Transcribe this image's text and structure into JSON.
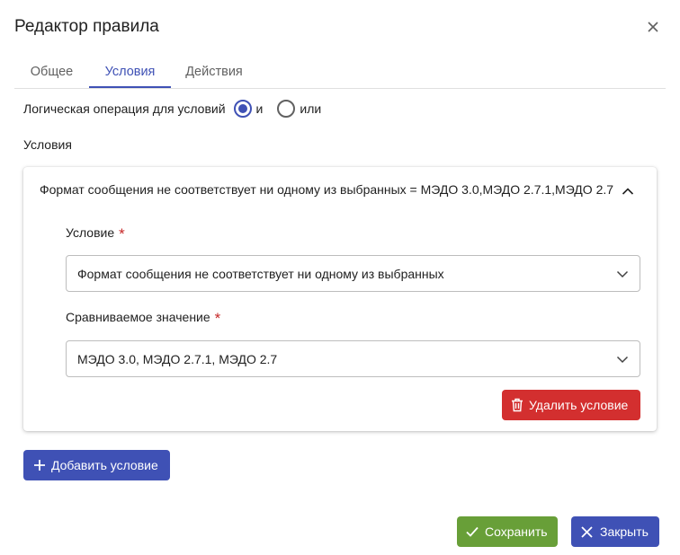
{
  "dialog": {
    "title": "Редактор правила",
    "close_icon": "close-icon"
  },
  "tabs": [
    {
      "label": "Общее",
      "active": false
    },
    {
      "label": "Условия",
      "active": true
    },
    {
      "label": "Действия",
      "active": false
    }
  ],
  "logic": {
    "label": "Логическая операция для условий",
    "options": [
      {
        "label": "и",
        "selected": true
      },
      {
        "label": "или",
        "selected": false
      }
    ]
  },
  "conditions": {
    "section_label": "Условия",
    "items": [
      {
        "summary": "Формат сообщения не соответствует ни одному из выбранных = МЭДО 3.0,МЭДО 2.7.1,МЭДО 2.7",
        "condition_label": "Условие",
        "condition_value": "Формат сообщения не соответствует ни одному из выбранных",
        "compare_label": "Сравниваемое значение",
        "compare_value": "МЭДО 3.0, МЭДО 2.7.1, МЭДО 2.7",
        "required_mark": "*",
        "delete_label": "Удалить условие"
      }
    ],
    "add_label": "Добавить условие"
  },
  "footer": {
    "save_label": "Сохранить",
    "close_label": "Закрыть"
  },
  "colors": {
    "primary": "#3f51b5",
    "danger": "#d32f2f",
    "success": "#689f38",
    "required": "#c62828"
  }
}
